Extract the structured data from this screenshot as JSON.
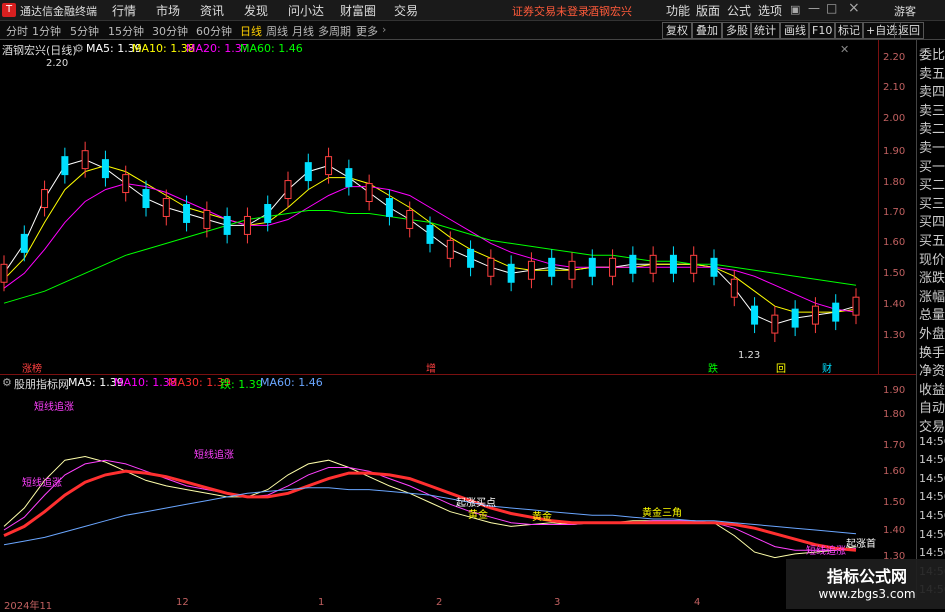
{
  "app": {
    "title": "通达信金融终端",
    "menus": [
      "行情",
      "市场",
      "资讯",
      "发现",
      "问小达",
      "财富圈",
      "交易"
    ],
    "account_status": "证券交易未登录",
    "stock": "酒钢宏兴",
    "right_menus": [
      "功能",
      "版面",
      "公式",
      "选项"
    ],
    "guest": "游客"
  },
  "toolbar": {
    "periods": [
      "分时",
      "1分钟",
      "5分钟",
      "15分钟",
      "30分钟",
      "60分钟",
      "日线",
      "周线",
      "月线",
      "多周期",
      "更多"
    ],
    "active": "日线",
    "tools": [
      "复权",
      "叠加",
      "多股",
      "统计",
      "画线",
      "F10",
      "标记",
      "+自选",
      "返回"
    ]
  },
  "main": {
    "legend": {
      "name": "酒钢宏兴(日线)",
      "ma5": "MA5: 1.39",
      "ma10": "MA10: 1.38",
      "ma20": "MA20: 1.37",
      "ma60": "MA60: 1.46"
    },
    "y_ticks": [
      "2.20",
      "2.10",
      "2.00",
      "1.90",
      "1.80",
      "1.70",
      "1.60",
      "1.50",
      "1.40",
      "1.30"
    ],
    "high_label": "2.20",
    "low_label": "1.23",
    "markers": [
      "涨榜",
      "增",
      "跌",
      "回",
      "财"
    ]
  },
  "sub": {
    "legend": {
      "name": "股朋指标网",
      "ma5": "MA5: 1.39",
      "ma10": "MA10: 1.38",
      "ma30": "MA30: 1.39",
      "die": "跌: 1.39",
      "ma60": "MA60: 1.46"
    },
    "y_ticks": [
      "1.90",
      "1.80",
      "1.70",
      "1.60",
      "1.50",
      "1.40",
      "1.30"
    ],
    "signals": [
      "短线追涨",
      "短线追涨",
      "短线追涨",
      "起涨买点",
      "黄金",
      "黄金",
      "黄金三角",
      "短线追涨",
      "起涨首"
    ]
  },
  "right_labels": [
    "委比",
    "卖五",
    "卖四",
    "卖三",
    "卖二",
    "卖一",
    "买一",
    "买二",
    "买三",
    "买四",
    "买五",
    "现价",
    "涨跌",
    "涨幅",
    "总量",
    "外盘",
    "换手",
    "净资",
    "收益",
    "自动",
    "交易",
    "14:56",
    "14:56",
    "14:56",
    "14:56",
    "14:56",
    "14:56",
    "14:56",
    "14:56",
    "14:56"
  ],
  "dates": [
    "2024年11",
    "12",
    "1",
    "2",
    "3",
    "4"
  ],
  "watermark": {
    "line1": "指标公式网",
    "line2": "www.zbgs3.com"
  },
  "colors": {
    "up": "#ff4040",
    "down": "#00e0ff",
    "ma5": "#ffffff",
    "ma10": "#ffff00",
    "ma20": "#ff00ff",
    "ma60": "#00ff00",
    "axis": "#c06060",
    "ma30": "#ff3030"
  },
  "chart_data": {
    "type": "line",
    "title": "酒钢宏兴(日线)",
    "ylim": [
      1.23,
      2.22
    ],
    "series": [
      {
        "name": "MA5",
        "values": [
          1.5,
          1.6,
          1.75,
          1.86,
          1.88,
          1.85,
          1.8,
          1.75,
          1.72,
          1.7,
          1.68,
          1.66,
          1.66,
          1.7,
          1.78,
          1.84,
          1.86,
          1.82,
          1.77,
          1.72,
          1.68,
          1.63,
          1.58,
          1.55,
          1.52,
          1.5,
          1.51,
          1.52,
          1.51,
          1.52,
          1.52,
          1.53,
          1.53,
          1.53,
          1.53,
          1.52,
          1.45,
          1.36,
          1.33,
          1.35,
          1.36,
          1.37,
          1.39
        ]
      },
      {
        "name": "MA10",
        "values": [
          1.48,
          1.55,
          1.67,
          1.78,
          1.84,
          1.86,
          1.84,
          1.8,
          1.76,
          1.72,
          1.7,
          1.68,
          1.66,
          1.67,
          1.72,
          1.78,
          1.82,
          1.82,
          1.8,
          1.76,
          1.72,
          1.67,
          1.62,
          1.58,
          1.55,
          1.52,
          1.51,
          1.51,
          1.51,
          1.52,
          1.52,
          1.52,
          1.53,
          1.53,
          1.53,
          1.52,
          1.49,
          1.44,
          1.39,
          1.37,
          1.37,
          1.37,
          1.38
        ]
      },
      {
        "name": "MA20",
        "values": [
          1.45,
          1.5,
          1.58,
          1.67,
          1.74,
          1.78,
          1.8,
          1.79,
          1.77,
          1.74,
          1.71,
          1.68,
          1.66,
          1.66,
          1.68,
          1.72,
          1.76,
          1.79,
          1.79,
          1.78,
          1.76,
          1.72,
          1.68,
          1.64,
          1.6,
          1.57,
          1.55,
          1.53,
          1.52,
          1.52,
          1.52,
          1.52,
          1.52,
          1.52,
          1.52,
          1.52,
          1.51,
          1.49,
          1.46,
          1.43,
          1.4,
          1.38,
          1.37
        ]
      },
      {
        "name": "MA60",
        "values": [
          1.4,
          1.42,
          1.44,
          1.47,
          1.5,
          1.53,
          1.56,
          1.58,
          1.6,
          1.62,
          1.64,
          1.66,
          1.68,
          1.69,
          1.7,
          1.71,
          1.71,
          1.7,
          1.7,
          1.69,
          1.68,
          1.67,
          1.65,
          1.63,
          1.61,
          1.6,
          1.59,
          1.58,
          1.57,
          1.56,
          1.56,
          1.55,
          1.54,
          1.54,
          1.53,
          1.53,
          1.52,
          1.51,
          1.5,
          1.49,
          1.48,
          1.47,
          1.46
        ]
      }
    ]
  }
}
